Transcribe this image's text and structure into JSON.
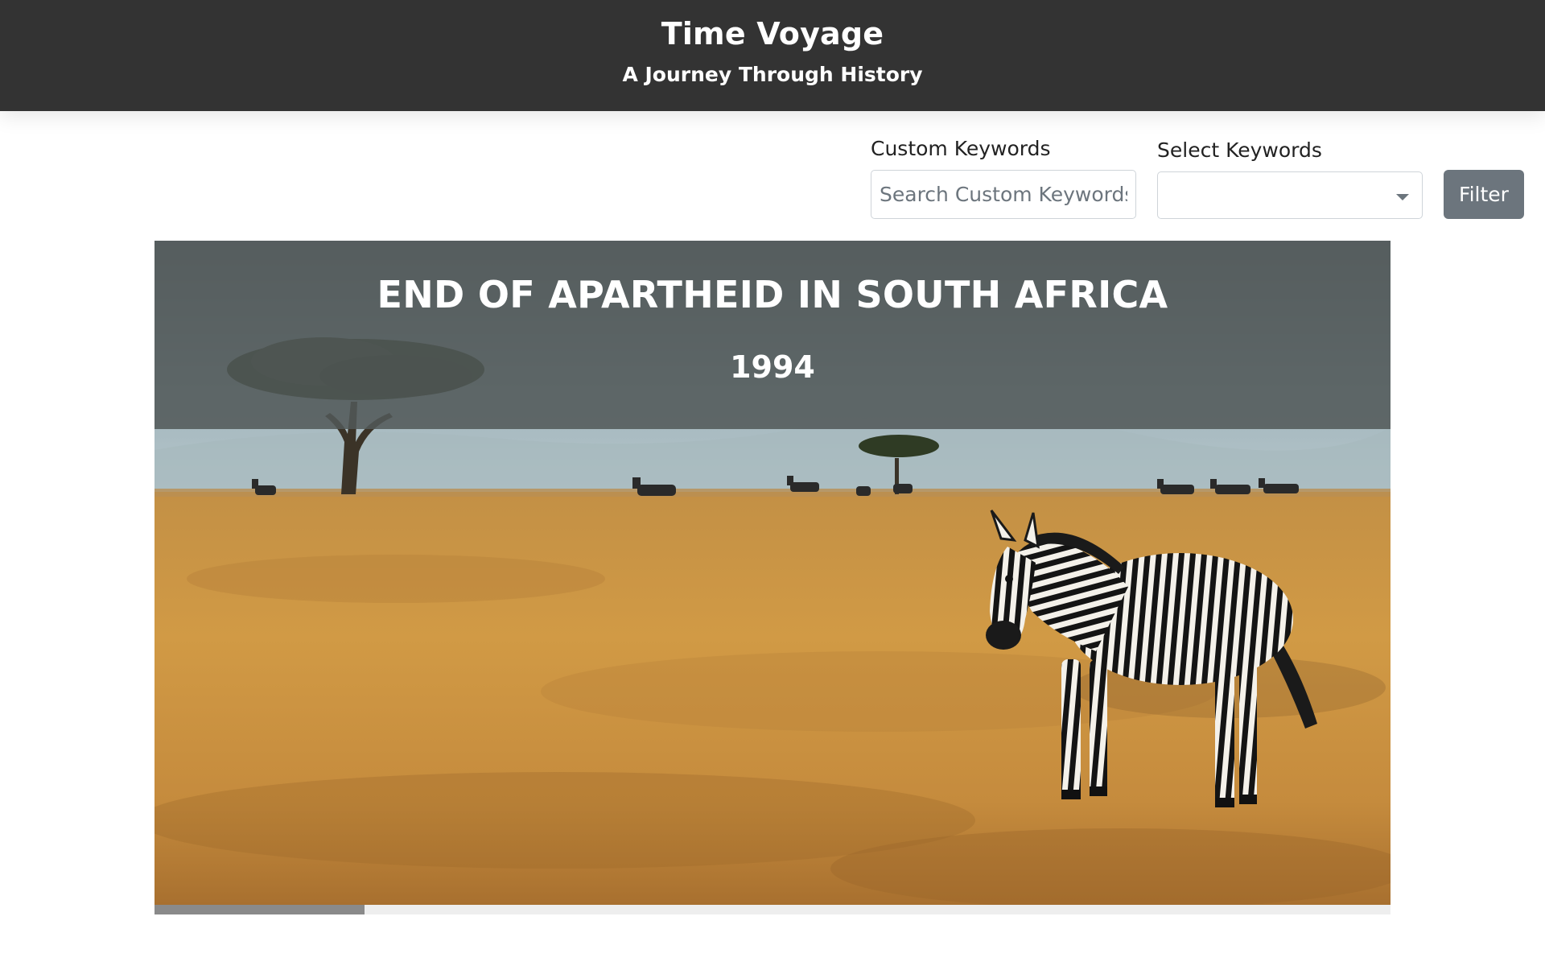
{
  "header": {
    "title": "Time Voyage",
    "subtitle": "A Journey Through History"
  },
  "filters": {
    "custom_label": "Custom Keywords",
    "custom_placeholder": "Search Custom Keywords",
    "custom_value": "",
    "select_label": "Select Keywords",
    "select_value": "",
    "filter_button": "Filter"
  },
  "slide": {
    "title": "END OF APARTHEID IN SOUTH AFRICA",
    "year": "1994",
    "image": "savanna-zebra-landscape",
    "progress_percent": 17
  },
  "colors": {
    "header_bg": "#333333",
    "button_bg": "#6c757d",
    "caption_bg": "#525858",
    "grass": "#c9923e"
  }
}
